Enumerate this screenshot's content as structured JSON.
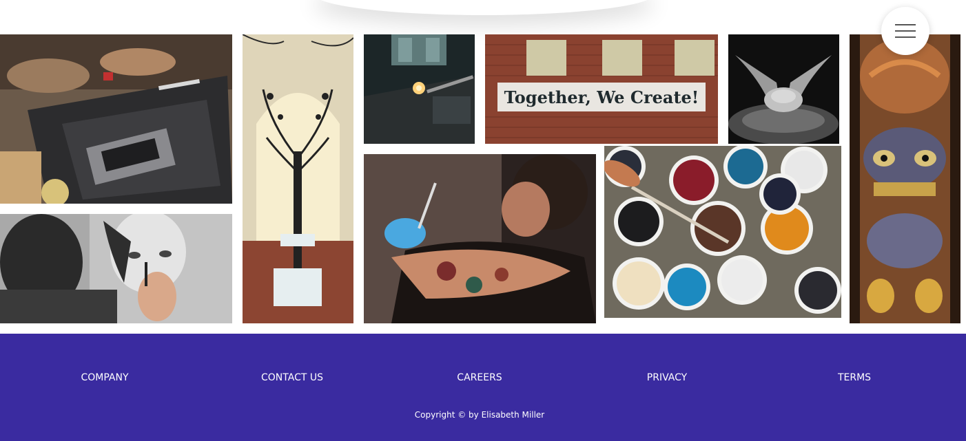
{
  "menu": {
    "icon": "hamburger-menu-icon"
  },
  "gallery": {
    "tiles": [
      {
        "subject": "spray-paint-stencil-art"
      },
      {
        "subject": "tree-sculpture-installation"
      },
      {
        "subject": "glassblowing-torch"
      },
      {
        "subject": "brick-wall-mural"
      },
      {
        "subject": "pottery-hands"
      },
      {
        "subject": "carved-totem"
      },
      {
        "subject": "pencil-portrait-drawing"
      },
      {
        "subject": "tattoo-artist"
      },
      {
        "subject": "paint-buckets"
      }
    ],
    "mural_text": "Together, We Create!"
  },
  "footer": {
    "links": [
      "COMPANY",
      "CONTACT US",
      "CAREERS",
      "PRIVACY",
      "TERMS"
    ],
    "copyright": "Copyright © by Elisabeth Miller"
  },
  "colors": {
    "footer_bg": "#3a2ba0",
    "footer_text": "#ffffff",
    "page_bg": "#ffffff"
  }
}
